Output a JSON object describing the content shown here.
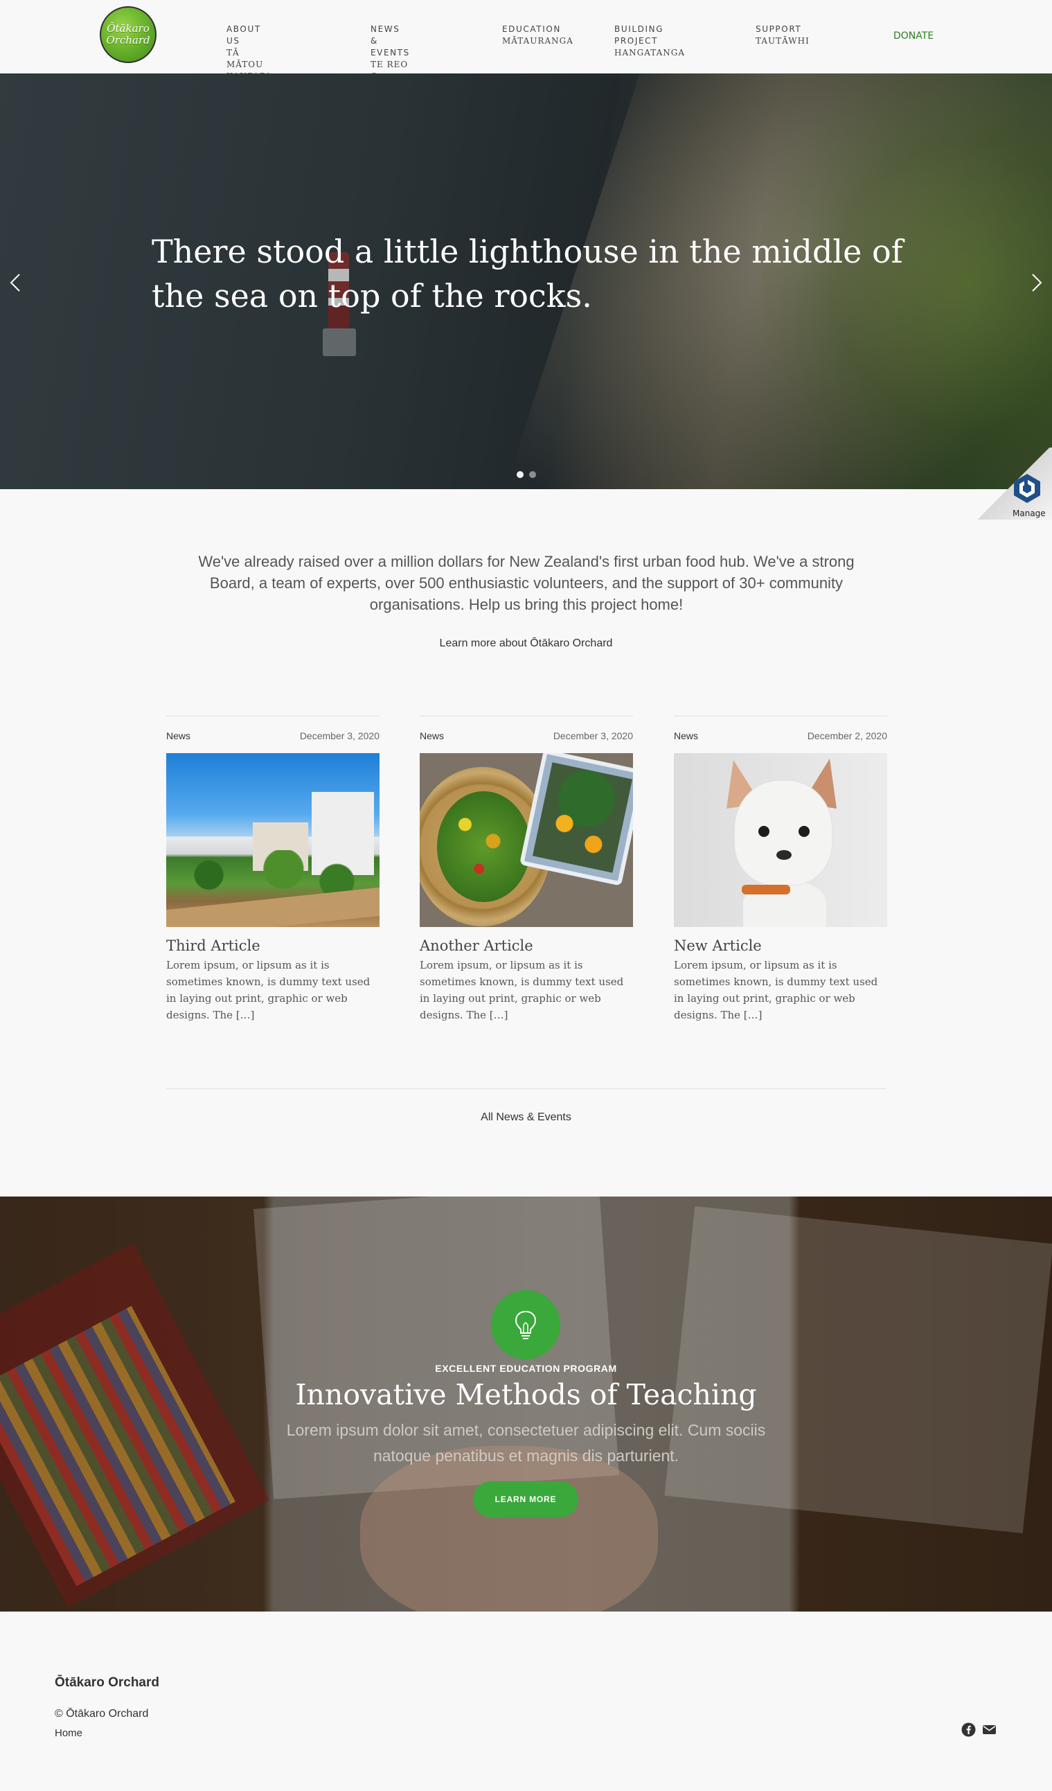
{
  "header": {
    "logo_text_line1": "Ōtākaro",
    "logo_text_line2": "Orchard",
    "nav": [
      {
        "top": "ABOUT US",
        "bottom": "TĀ MĀTOU KAUPAPA"
      },
      {
        "top": "NEWS & EVENTS",
        "bottom": "TE REO O KARERE"
      },
      {
        "top": "EDUCATION",
        "bottom": "MĀTAURANGA"
      },
      {
        "top": "BUILDING PROJECT",
        "bottom": "HANGATANGA"
      },
      {
        "top": "SUPPORT",
        "bottom": "TAUTĀWHI"
      }
    ],
    "donate": "DONATE"
  },
  "hero": {
    "heading": "There stood a little lighthouse in the middle of the sea on top of the rocks.",
    "slides_count": 2,
    "active_slide": 1
  },
  "manage_widget": {
    "label": "Manage"
  },
  "intro": {
    "text": "We've already raised over a million dollars for New Zealand's first urban food hub. We've a strong Board, a team of experts, over 500 enthusiastic volunteers, and the support of 30+ community organisations. Help us bring this project home!",
    "link": "Learn more about Ōtākaro Orchard"
  },
  "articles": [
    {
      "category": "News",
      "date": "December 3, 2020",
      "title": "Third Article",
      "excerpt": "Lorem ipsum, or lipsum as it is sometimes known, is dummy text used in laying out print, graphic or web designs. The […]"
    },
    {
      "category": "News",
      "date": "December 3, 2020",
      "title": "Another Article",
      "excerpt": "Lorem ipsum, or lipsum as it is sometimes known, is dummy text used in laying out print, graphic or web designs. The […]"
    },
    {
      "category": "News",
      "date": "December 2, 2020",
      "title": "New Article",
      "excerpt": "Lorem ipsum, or lipsum as it is sometimes known, is dummy text used in laying out print, graphic or web designs. The […]"
    }
  ],
  "all_news_link": "All News & Events",
  "education": {
    "kicker": "EXCELLENT EDUCATION PROGRAM",
    "heading": "Innovative Methods of Teaching",
    "subtext": "Lorem ipsum dolor sit amet, consectetuer adipiscing elit. Cum sociis natoque penatibus et magnis dis parturient.",
    "button": "LEARN MORE",
    "icon": "lightbulb-icon"
  },
  "footer": {
    "title": "Ōtākaro Orchard",
    "copyright": "© Ōtākaro Orchard",
    "home_link": "Home",
    "social": [
      "facebook-icon",
      "email-icon"
    ]
  },
  "colors": {
    "accent_green": "#3aa83a",
    "donate_green": "#2f7d24",
    "page_bg": "#f8f8f8"
  }
}
